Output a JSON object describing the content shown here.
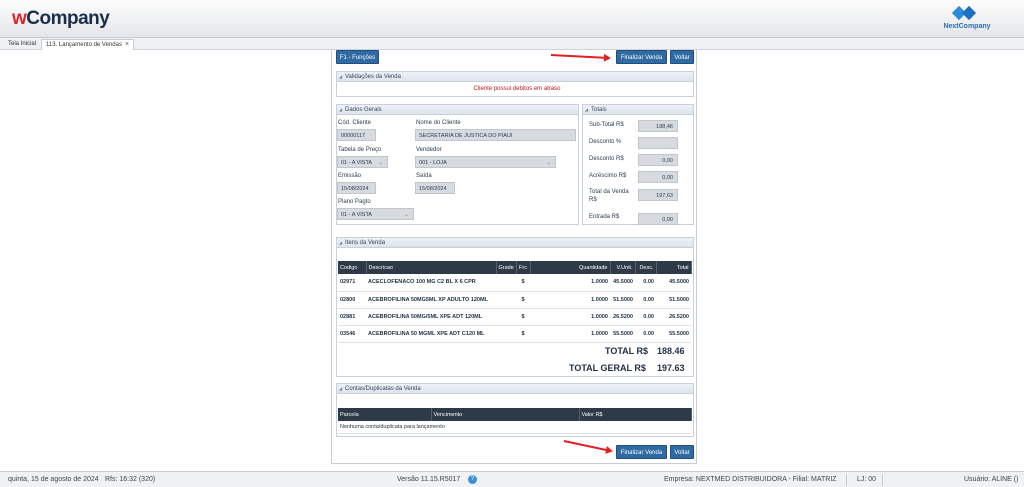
{
  "app": {
    "logo_prefix": "w",
    "logo_rest": "Company",
    "right_brand": "NextCompany"
  },
  "tabs": [
    {
      "label": "Tela Inicial"
    },
    {
      "label": "113. Lançamento de Vendas",
      "close": "×"
    }
  ],
  "toolbar": {
    "functions_label": "F1 - Funções",
    "finalize_label": "Finalizar Venda",
    "back_label": "Voltar"
  },
  "validations": {
    "title": "Validações da Venda",
    "message": "Cliente possui debitos em atraso"
  },
  "general": {
    "title": "Dados Gerais",
    "client_code_label": "Cód. Cliente",
    "client_code": "00000117",
    "client_name_label": "Nome do Cliente",
    "client_name": "SECRETARIA DE JUSTICA DO PIAUI",
    "price_table_label": "Tabela de Preço",
    "price_table": "01 - A VISTA",
    "seller_label": "Vendedor",
    "seller": "001 - LOJA",
    "issue_label": "Emissão",
    "issue_date": "15/08/2024",
    "exit_label": "Saída",
    "exit_date": "15/08/2024",
    "payment_label": "Plano Pagto",
    "payment": "01 - A VISTA"
  },
  "totals": {
    "title": "Totais",
    "subtotal_label": "Sub-Total R$",
    "subtotal": "188,46",
    "discount_pct_label": "Desconto %",
    "discount_pct": "",
    "discount_label": "Desconto R$",
    "discount": "0,00",
    "increase_label": "Acréscimo R$",
    "increase": "0,00",
    "total_sale_label_1": "Total da Venda",
    "total_sale_label_2": "R$",
    "total_sale": "197,63",
    "entry_label": "Entrada R$",
    "entry": "0,00"
  },
  "items": {
    "title": "Itens da Venda",
    "headers": [
      "Codigo",
      "Descricao",
      "Grade",
      "Frc",
      "Quantidade",
      "V.Unit.",
      "Desc.",
      "Total"
    ],
    "rows": [
      {
        "code": "02971",
        "desc": "ACECLOFENACO 100 MG C2 BL X 6 CPR",
        "frc": "$",
        "qty": "1.0000",
        "unit": "45.5000",
        "disc": "0.00",
        "total": "45.5000"
      },
      {
        "code": "02800",
        "desc": "ACEBROFILINA 50MG5ML XP ADULTO 120ML",
        "frc": "$",
        "qty": "1.0000",
        "unit": "51.5000",
        "disc": "0.00",
        "total": "51.5000"
      },
      {
        "code": "02881",
        "desc": "ACEBROFILINA 50MG/5ML XPE ADT 120ML",
        "frc": "$",
        "qty": "1.0000",
        "unit": "26.5200",
        "disc": "0.00",
        "total": "26.5200"
      },
      {
        "code": "03546",
        "desc": "ACEBROFILINA 50 MGML XPE ADT C120 ML",
        "frc": "$",
        "qty": "1.0000",
        "unit": "55.5000",
        "disc": "0.00",
        "total": "55.5000"
      }
    ],
    "total_label": "TOTAL R$",
    "total_value": "188.46",
    "grand_total_label": "TOTAL GERAL R$",
    "grand_total_value": "197.63"
  },
  "accounts": {
    "title": "Contas/Duplicatas da Venda",
    "headers": [
      "Parcela",
      "Vencimento",
      "Valor R$"
    ],
    "empty": "Nenhuma conta/duplicata para lançamento"
  },
  "status": {
    "date": "quinta, 15 de agosto de 2024",
    "rfs": "Rfs: 16:32 (320)",
    "version": "Versão 11.15.R5017",
    "company": "Empresa: NEXTMED DISTRIBUIDORA - Filial: MATRIZ",
    "lj": "LJ: 00",
    "user": "Usuário: ALINE ()"
  },
  "colors": {
    "accent": "#2f6aa3",
    "alert": "#c0181f",
    "arrow": "#e21f26",
    "table_header": "#2e3a48"
  }
}
